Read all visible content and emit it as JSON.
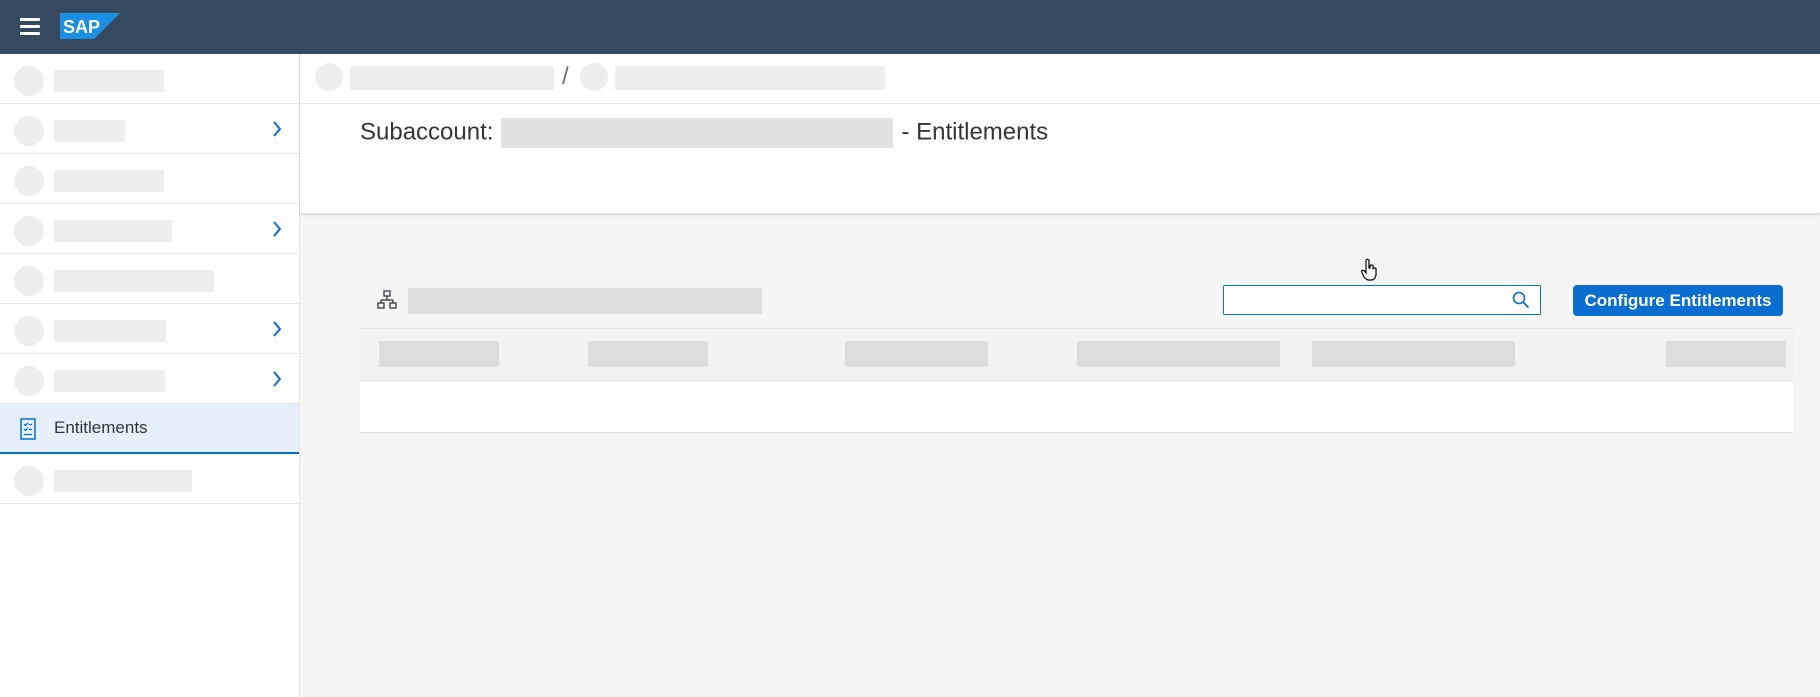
{
  "shellbar": {
    "menu_icon": "hamburger-icon",
    "logo_text": "SAP",
    "background": "#354a5f"
  },
  "sidebar": {
    "selected_item": {
      "label": "Entitlements",
      "icon": "entitlements-icon"
    }
  },
  "main": {
    "title_prefix": "Subaccount:",
    "title_suffix": "- Entitlements",
    "search": {
      "value": "",
      "placeholder": ""
    },
    "configure_button": "Configure Entitlements"
  },
  "colors": {
    "accent": "#0a6ed1",
    "selection_bg": "#e5f0fa",
    "content_bg": "#f5f5f5"
  }
}
